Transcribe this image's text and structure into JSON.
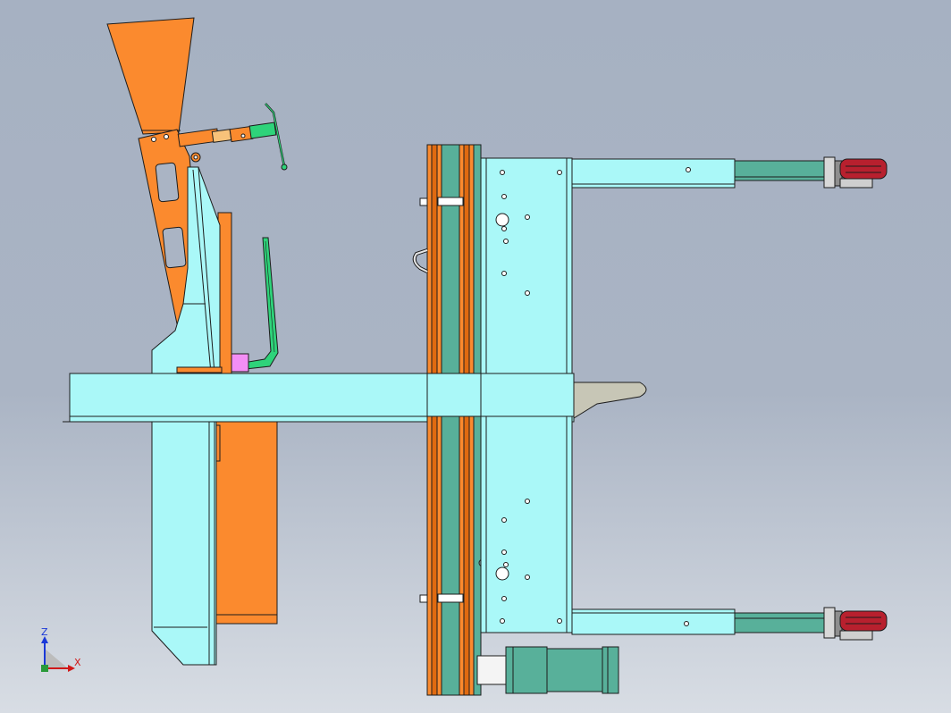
{
  "viewport": {
    "background_top": "#a6b1c2",
    "background_bottom": "#d8dde4"
  },
  "colors": {
    "frame_cyan": "#aaf8f8",
    "part_orange": "#fb8a2e",
    "guard_green": "#2ed37a",
    "block_magenta": "#f38ef5",
    "motor_teal": "#58b09a",
    "wheel_red": "#b8202e",
    "edge": "#1c1c1c"
  },
  "triad": {
    "z_label": "Z",
    "x_label": "X",
    "z_color": "#1a38d8",
    "x_color": "#d01818"
  }
}
